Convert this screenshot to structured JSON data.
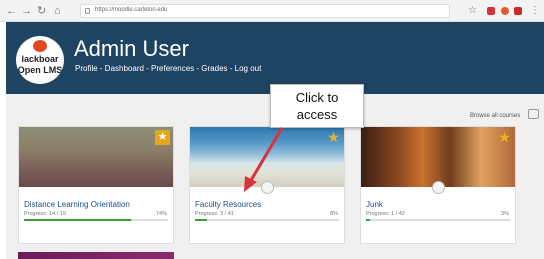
{
  "browser": {
    "url": "https://moodle.carleton.edu",
    "nav_icons": [
      "back-icon",
      "forward-icon",
      "reload-icon",
      "home-icon"
    ]
  },
  "header": {
    "logo_text": [
      "lackboar",
      "Open LMS"
    ],
    "user_name": "Admin User",
    "menu": [
      "Profile",
      "Dashboard",
      "Preferences",
      "Grades",
      "Log out"
    ],
    "menu_separator": " - ",
    "color": "#1e4363"
  },
  "callout": {
    "line1": "Click to",
    "line2": "access",
    "arrow_color": "#d8323c"
  },
  "browse_all": "Browse all courses",
  "courses": [
    {
      "name": "Distance Learning Orientation",
      "progress": "Progress: 14 / 19",
      "percent": "74%",
      "progress_value": 74
    },
    {
      "name": "Faculty Resources",
      "progress": "Progress: 3 / 41",
      "percent": "8%",
      "progress_value": 8
    },
    {
      "name": "Junk",
      "progress": "Progress: 1 / 42",
      "percent": "3%",
      "progress_value": 3
    }
  ]
}
